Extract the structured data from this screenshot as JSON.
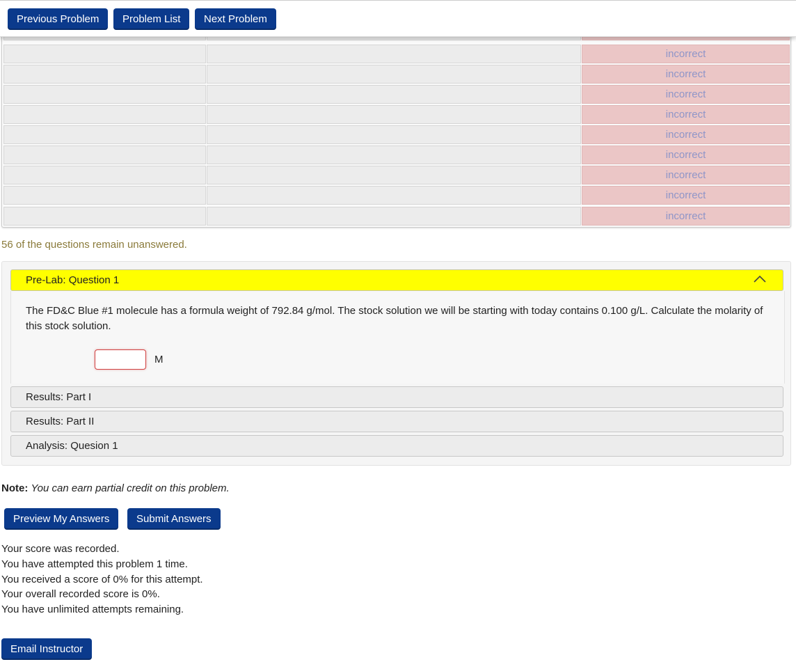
{
  "nav": {
    "previous_label": "Previous Problem",
    "list_label": "Problem List",
    "next_label": "Next Problem"
  },
  "results_table": {
    "rows": [
      {
        "status": ""
      },
      {
        "status": "incorrect"
      },
      {
        "status": "incorrect"
      },
      {
        "status": "incorrect"
      },
      {
        "status": "incorrect"
      },
      {
        "status": "incorrect"
      },
      {
        "status": "incorrect"
      },
      {
        "status": "incorrect"
      },
      {
        "status": "incorrect"
      },
      {
        "status": "incorrect"
      }
    ]
  },
  "unanswered_message": "56 of the questions remain unanswered.",
  "accordion": {
    "sections": [
      {
        "title": "Pre-Lab: Question 1",
        "expanded": true
      },
      {
        "title": "Results: Part I",
        "expanded": false
      },
      {
        "title": "Results: Part II",
        "expanded": false
      },
      {
        "title": "Analysis: Quesion 1",
        "expanded": false
      }
    ],
    "question_text": "The FD&C Blue #1 molecule has a formula weight of 792.84 g/mol. The stock solution we will be starting with today contains 0.100 g/L. Calculate the molarity of this stock solution.",
    "answer_value": "",
    "answer_unit": "M",
    "collapse_icon": "chevron-up-icon"
  },
  "note": {
    "label": "Note:",
    "text": "You can earn partial credit on this problem."
  },
  "actions": {
    "preview_label": "Preview My Answers",
    "submit_label": "Submit Answers"
  },
  "score_info": [
    "Your score was recorded.",
    "You have attempted this problem 1 time.",
    "You received a score of 0% for this attempt.",
    "Your overall recorded score is 0%.",
    "You have unlimited attempts remaining."
  ],
  "email_label": "Email Instructor",
  "colors": {
    "button": "#0b3a8c",
    "incorrect_bg": "#ebc6c6",
    "incorrect_text": "#8f95c8",
    "active_header": "#ffff00",
    "unanswered_text": "#8a7a3a"
  }
}
